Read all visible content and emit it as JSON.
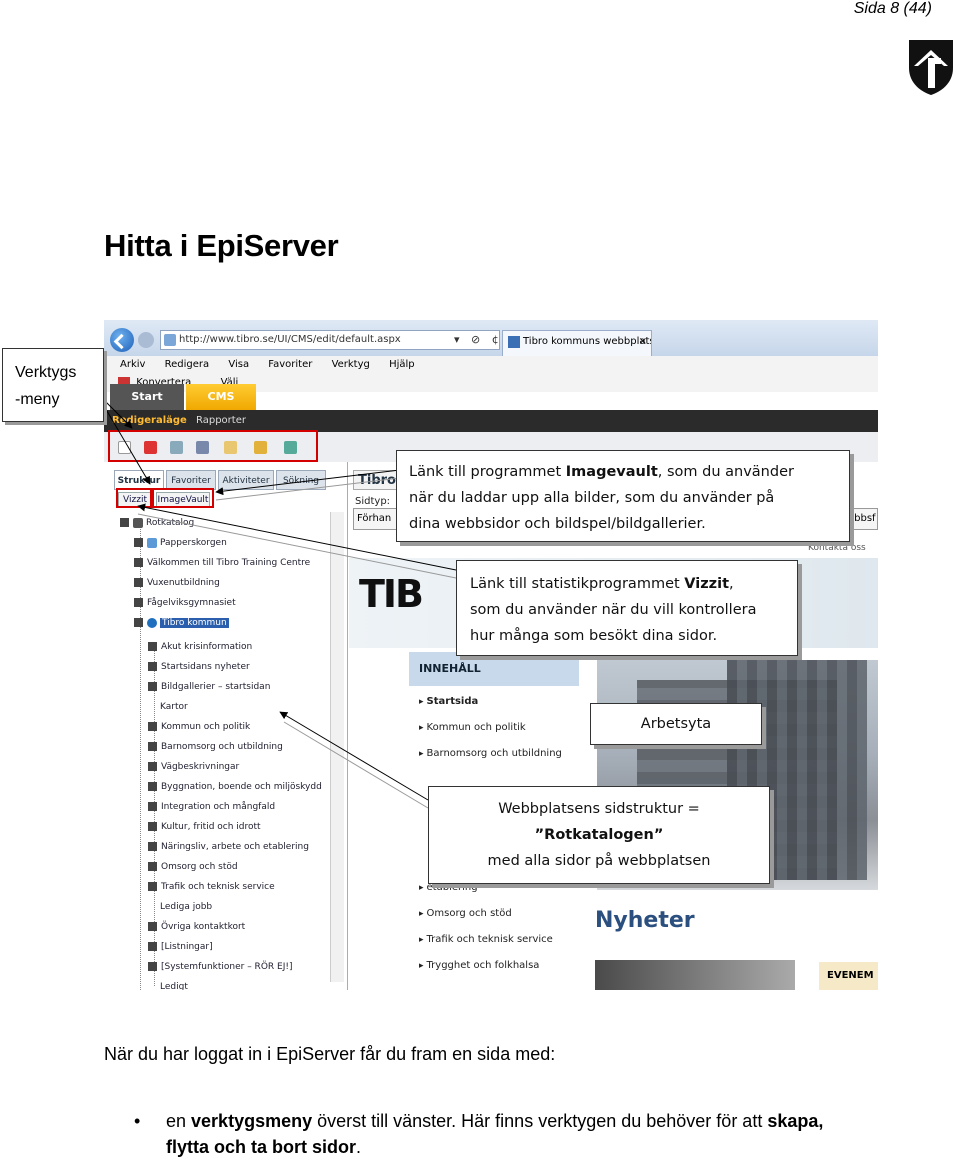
{
  "page": {
    "number": "Sida 8 (44)",
    "title": "Hitta i EpiServer"
  },
  "browser": {
    "url": "http://www.tibro.se/UI/CMS/edit/default.aspx",
    "url_buttons": "▾ ⊘ ¢ ✕",
    "tab_title": "Tibro kommuns webbplats ...",
    "menu": [
      "Arkiv",
      "Redigera",
      "Visa",
      "Favoriter",
      "Verktyg",
      "Hjälp"
    ],
    "cmd_konvertera": "Konvertera",
    "cmd_valj": "Välj"
  },
  "cms": {
    "tab_start": "Start",
    "tab_cms": "CMS",
    "mode_edit": "Redigeraläge",
    "mode_reports": "Rapporter",
    "side_tabs": [
      "Struktur",
      "Favoriter",
      "Aktiviteter",
      "Sökning"
    ],
    "btn_vizzit": "Vizzit",
    "btn_imagevault": "ImageVault",
    "tree_root": "Rotkatalog",
    "tree": [
      "Papperskorgen",
      "Välkommen till Tibro Training Centre",
      "Vuxenutbildning",
      "Fågelviksgymnasiet",
      "Tibro kommun",
      "Akut krisinformation",
      "Startsidans nyheter",
      "Bildgallerier – startsidan",
      "Kartor",
      "Kommun och politik",
      "Barnomsorg och utbildning",
      "Vägbeskrivningar",
      "Byggnation, boende och miljöskydd",
      "Integration och mångfald",
      "Kultur, fritid och idrott",
      "Näringsliv, arbete och etablering",
      "Omsorg och stöd",
      "Trafik och teknisk service",
      "Lediga jobb",
      "Övriga kontaktkort",
      "[Listningar]",
      "[Systemfunktioner – RÖR EJ!]",
      "Ledigt"
    ]
  },
  "site": {
    "title_tab": "Tibro",
    "sidtyp": "Sidtyp:",
    "forhand": "Förhan",
    "webbsf": "ebbsf",
    "kontakta": "Kontakta oss",
    "logo": "TIB",
    "innehall": "INNEHÅLL",
    "nav": [
      "Startsida",
      "Kommun och politik",
      "Barnomsorg och utbildning",
      "etablering",
      "Omsorg och stöd",
      "Trafik och teknisk service",
      "Trygghet och folkhalsa"
    ],
    "nyheter": "Nyheter",
    "evenem": "EVENEM"
  },
  "callouts": {
    "verktygs_line1": "Verktygs",
    "verktygs_line2": "-meny",
    "imagevault_l1a": "Länk till programmet ",
    "imagevault_l1b": "Imagevault",
    "imagevault_l1c": ", som du använder",
    "imagevault_l2": "när du laddar upp alla bilder, som du använder på",
    "imagevault_l3": "dina webbsidor och bildspel/bildgallerier.",
    "vizzit_l1a": "Länk till statistikprogrammet ",
    "vizzit_l1b": "Vizzit",
    "vizzit_l1c": ",",
    "vizzit_l2": "som du använder när du vill kontrollera",
    "vizzit_l3": "hur många som besökt dina sidor.",
    "arbetsyta": "Arbetsyta",
    "struktur_l1": "Webbplatsens sidstruktur =",
    "struktur_l2": "”Rotkatalogen”",
    "struktur_l3": "med alla sidor på webbplatsen"
  },
  "text": {
    "intro": "När du har loggat in i EpiServer får du fram en sida med:",
    "bullet_dot": "•",
    "bullet_a": "en ",
    "bullet_b": "verktygsmeny",
    "bullet_c": " överst till vänster. Här finns verktygen du behöver för att ",
    "bullet_d": "skapa,",
    "bullet_e": "flytta och ta bort sidor",
    "bullet_f": "."
  },
  "colors": {
    "highlight_red": "#d40000",
    "cms_orange": "#f0a800",
    "mode_bar": "#2b2b2b"
  },
  "icons": [
    "back-icon",
    "page-icon",
    "shield-logo-icon"
  ]
}
